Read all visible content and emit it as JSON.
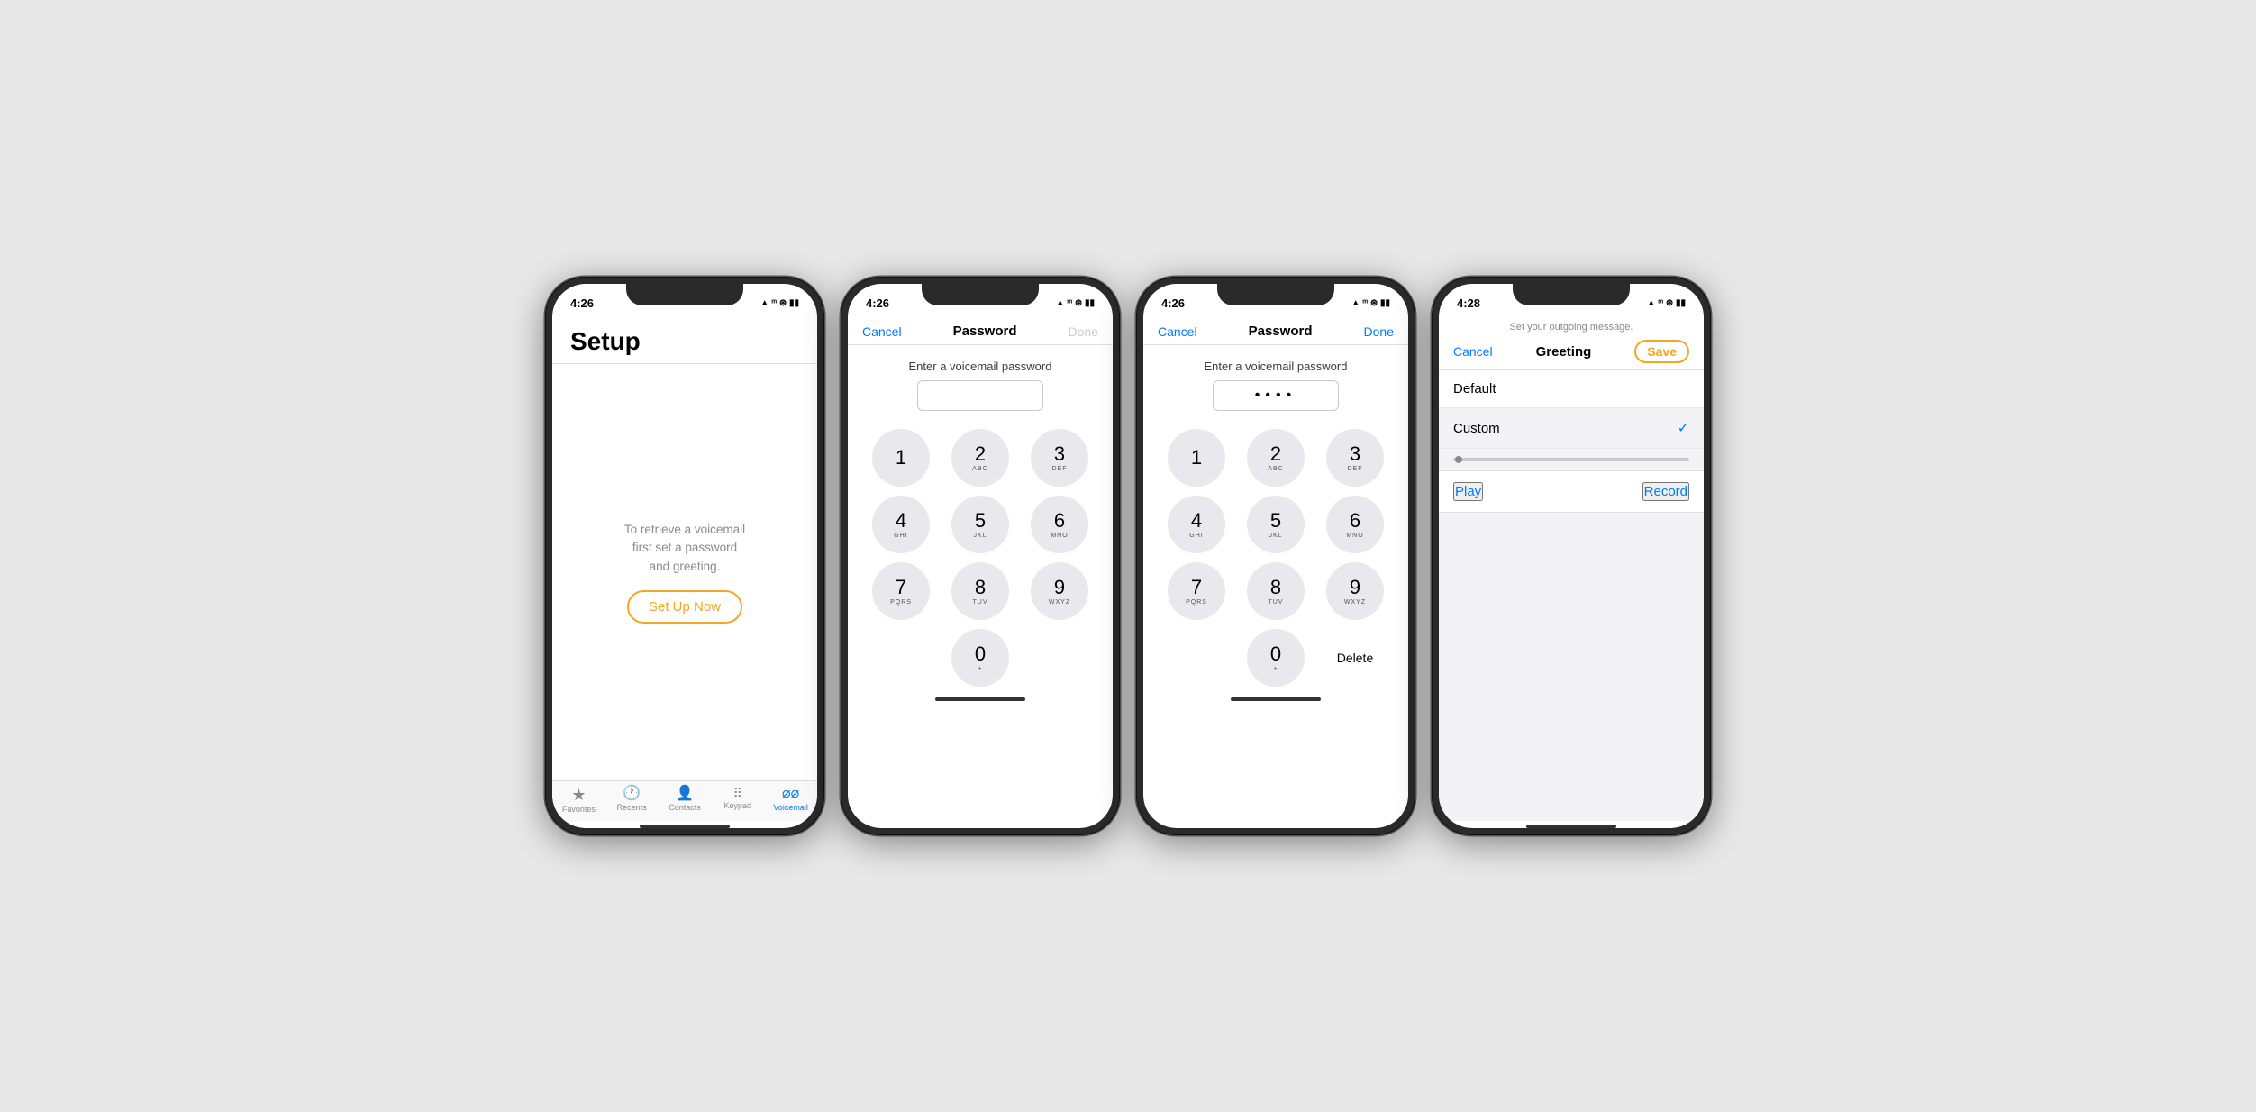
{
  "phones": [
    {
      "id": "phone1",
      "status_time": "4:26",
      "screen": "setup",
      "setup": {
        "title": "Setup",
        "description": "To retrieve a voicemail\nfirst set a password\nand greeting.",
        "button_label": "Set Up Now"
      },
      "tabs": [
        {
          "label": "Favorites",
          "icon": "★",
          "active": false
        },
        {
          "label": "Recents",
          "icon": "🕐",
          "active": false
        },
        {
          "label": "Contacts",
          "icon": "👤",
          "active": false
        },
        {
          "label": "Keypad",
          "icon": "⋯",
          "active": false
        },
        {
          "label": "Voicemail",
          "icon": "∞",
          "active": true
        }
      ]
    },
    {
      "id": "phone2",
      "status_time": "4:26",
      "screen": "password_empty",
      "nav": {
        "cancel": "Cancel",
        "title": "Password",
        "done": "Done",
        "done_active": false
      },
      "pw_label": "Enter a voicemail password",
      "pw_value": "",
      "dialpad": [
        {
          "num": "1",
          "letters": ""
        },
        {
          "num": "2",
          "letters": "ABC"
        },
        {
          "num": "3",
          "letters": "DEF"
        },
        {
          "num": "4",
          "letters": "GHI"
        },
        {
          "num": "5",
          "letters": "JKL"
        },
        {
          "num": "6",
          "letters": "MNO"
        },
        {
          "num": "7",
          "letters": "PQRS"
        },
        {
          "num": "8",
          "letters": "TUV"
        },
        {
          "num": "9",
          "letters": "WXYZ"
        }
      ],
      "zero": {
        "num": "0",
        "letters": "+"
      },
      "show_delete": false
    },
    {
      "id": "phone3",
      "status_time": "4:26",
      "screen": "password_filled",
      "nav": {
        "cancel": "Cancel",
        "title": "Password",
        "done": "Done",
        "done_active": true
      },
      "pw_label": "Enter a voicemail password",
      "pw_value": "••••",
      "dialpad": [
        {
          "num": "1",
          "letters": ""
        },
        {
          "num": "2",
          "letters": "ABC"
        },
        {
          "num": "3",
          "letters": "DEF"
        },
        {
          "num": "4",
          "letters": "GHI"
        },
        {
          "num": "5",
          "letters": "JKL"
        },
        {
          "num": "6",
          "letters": "MNO"
        },
        {
          "num": "7",
          "letters": "PQRS"
        },
        {
          "num": "8",
          "letters": "TUV"
        },
        {
          "num": "9",
          "letters": "WXYZ"
        }
      ],
      "zero": {
        "num": "0",
        "letters": "+"
      },
      "show_delete": true,
      "delete_label": "Delete"
    },
    {
      "id": "phone4",
      "status_time": "4:28",
      "screen": "greeting",
      "subtitle": "Set your outgoing message.",
      "nav": {
        "cancel": "Cancel",
        "title": "Greeting",
        "save": "Save"
      },
      "greeting_items": [
        {
          "label": "Default",
          "selected": false
        },
        {
          "label": "Custom",
          "selected": true
        }
      ],
      "play_label": "Play",
      "record_label": "Record"
    }
  ]
}
